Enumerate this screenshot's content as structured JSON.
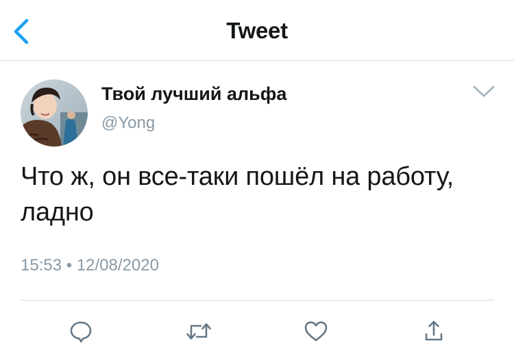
{
  "nav": {
    "title": "Tweet",
    "back_icon": "chevron-left-icon"
  },
  "tweet": {
    "author": {
      "name": "Твой лучший альфа",
      "handle": "@Yong"
    },
    "text": "Что ж, он все-таки пошёл на работу, ладно",
    "time": "15:53",
    "separator": "•",
    "date": "12/08/2020"
  },
  "actions": [
    "reply-icon",
    "retweet-icon",
    "like-icon",
    "share-icon"
  ],
  "colors": {
    "accent": "#1da1f2",
    "text": "#14171a",
    "secondary_text": "#8899a6",
    "divider": "#d6dbe0",
    "icon": "#657786"
  }
}
